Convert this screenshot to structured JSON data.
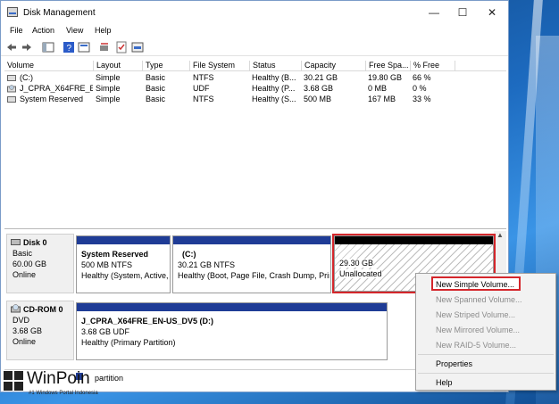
{
  "window": {
    "title": "Disk Management",
    "menus": [
      "File",
      "Action",
      "View",
      "Help"
    ]
  },
  "volume_list": {
    "columns": [
      "Volume",
      "Layout",
      "Type",
      "File System",
      "Status",
      "Capacity",
      "Free Spa...",
      "% Free"
    ],
    "rows": [
      [
        "(C:)",
        "Simple",
        "Basic",
        "NTFS",
        "Healthy (B...",
        "30.21 GB",
        "19.80 GB",
        "66 %"
      ],
      [
        "J_CPRA_X64FRE_E...",
        "Simple",
        "Basic",
        "UDF",
        "Healthy (P...",
        "3.68 GB",
        "0 MB",
        "0 %"
      ],
      [
        "System Reserved",
        "Simple",
        "Basic",
        "NTFS",
        "Healthy (S...",
        "500 MB",
        "167 MB",
        "33 %"
      ]
    ]
  },
  "disks": {
    "disk0": {
      "name": "Disk 0",
      "type": "Basic",
      "size": "60.00 GB",
      "status": "Online",
      "partitions": {
        "system_reserved": {
          "name": "System Reserved",
          "detail": "500 MB NTFS",
          "status": "Healthy (System, Active,"
        },
        "c": {
          "name": "(C:)",
          "detail": "30.21 GB NTFS",
          "status": "Healthy (Boot, Page File, Crash Dump, Prin"
        },
        "unallocated": {
          "size": "29.30 GB",
          "label": "Unallocated"
        }
      }
    },
    "cdrom0": {
      "name": "CD-ROM 0",
      "type": "DVD",
      "size": "3.68 GB",
      "status": "Online",
      "partition": {
        "name": "J_CPRA_X64FRE_EN-US_DV5  (D:)",
        "detail": "3.68 GB UDF",
        "status": "Healthy (Primary Partition)"
      }
    }
  },
  "legend": {
    "text": "partition"
  },
  "context_menu": {
    "items": [
      {
        "label": "New Simple Volume...",
        "enabled": true
      },
      {
        "label": "New Spanned Volume...",
        "enabled": false
      },
      {
        "label": "New Striped Volume...",
        "enabled": false
      },
      {
        "label": "New Mirrored Volume...",
        "enabled": false
      },
      {
        "label": "New RAID-5 Volume...",
        "enabled": false
      },
      {
        "label": "Properties",
        "enabled": true
      },
      {
        "label": "Help",
        "enabled": true
      }
    ]
  },
  "watermark": {
    "brand": "WinPoin",
    "tagline": "#1 Windows Portal Indonesia"
  },
  "colors": {
    "partition_bar": "#1f3c96",
    "highlight": "#d4262b",
    "unallocated_bar": "#000000"
  }
}
